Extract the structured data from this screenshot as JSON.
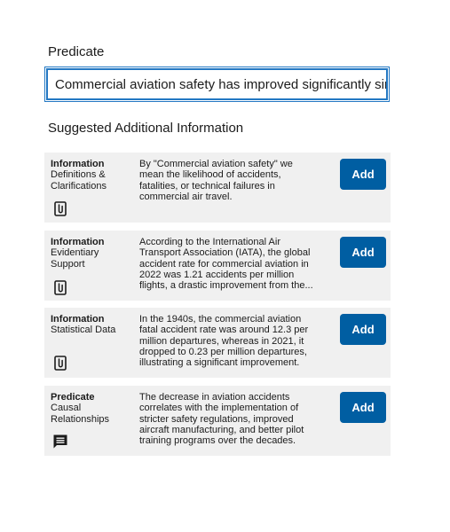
{
  "predicate": {
    "label": "Predicate",
    "value": "Commercial aviation safety has improved significantly since"
  },
  "suggested": {
    "label": "Suggested Additional Information",
    "cards": [
      {
        "type": "Information",
        "category": "Definitions & Clarifications",
        "text": "By \"Commercial aviation safety\" we mean the likelihood of accidents, fatalities, or technical failures in commercial air travel.",
        "icon": "attachment-icon",
        "button": "Add"
      },
      {
        "type": "Information",
        "category": "Evidentiary Support",
        "text": "According to the International Air Transport Association (IATA), the global accident rate for commercial aviation in 2022 was 1.21 accidents per million flights, a drastic improvement from the...",
        "icon": "attachment-icon",
        "button": "Add"
      },
      {
        "type": "Information",
        "category": "Statistical Data",
        "text": "In the 1940s, the commercial aviation fatal accident rate was around 12.3 per million departures, whereas in 2021, it dropped to 0.23 per million departures, illustrating a significant improvement.",
        "icon": "attachment-icon",
        "button": "Add"
      },
      {
        "type": "Predicate",
        "category": "Causal Relationships",
        "text": "The decrease in aviation accidents correlates with the implementation of stricter safety regulations, improved aircraft manufacturing, and better pilot training programs over the decades.",
        "icon": "comment-icon",
        "button": "Add"
      }
    ]
  },
  "colors": {
    "accent": "#005ea2",
    "focus_border": "#2378c3",
    "card_bg": "#f0f0f0"
  }
}
